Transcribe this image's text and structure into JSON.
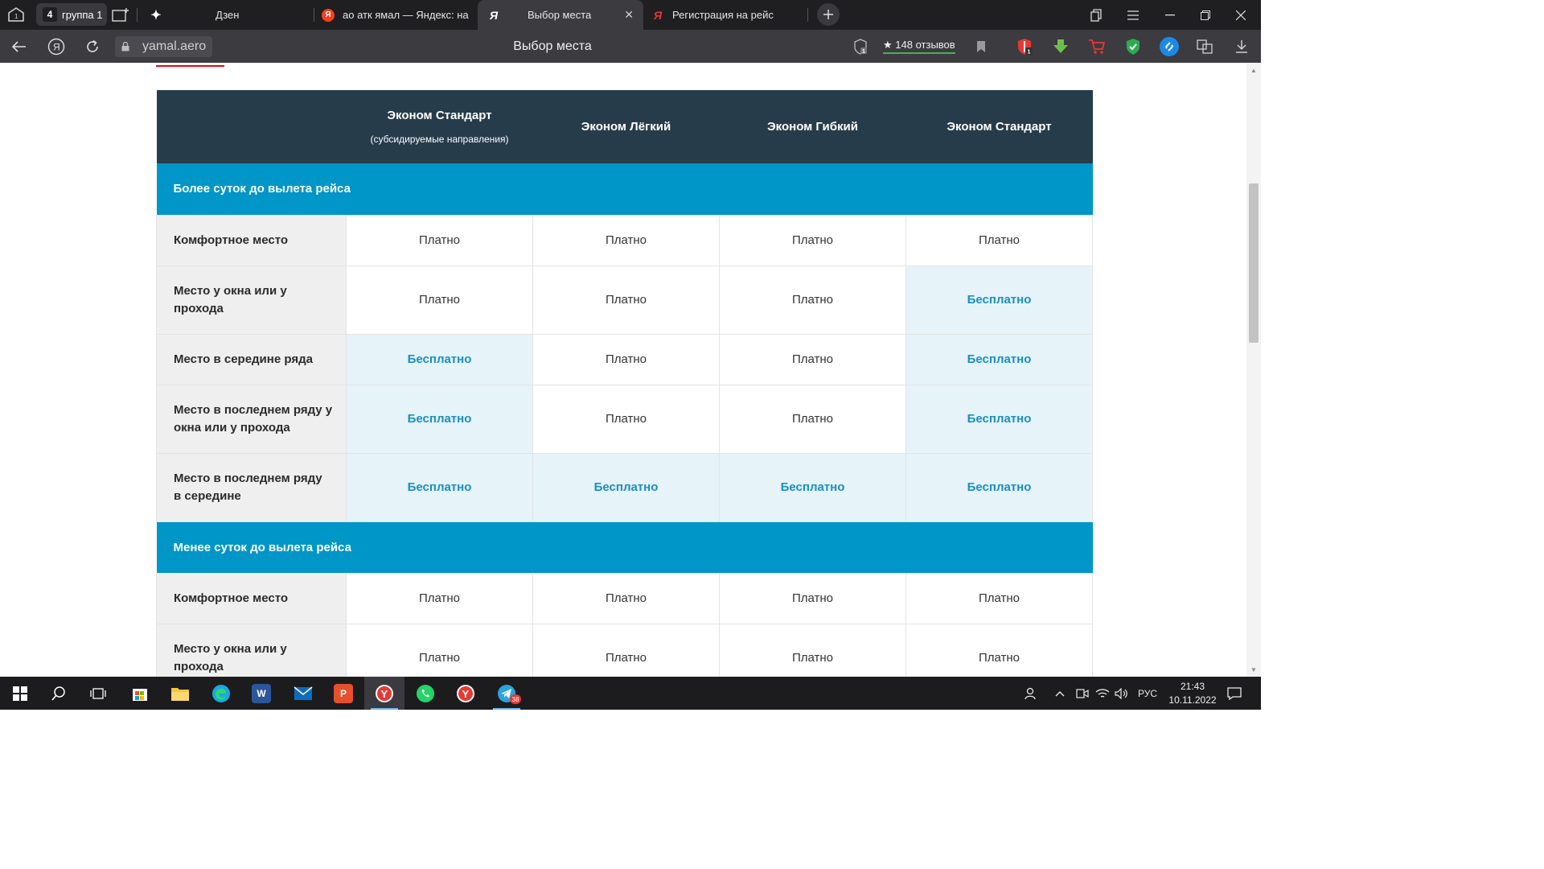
{
  "browser": {
    "tab_group": {
      "count": "4",
      "label": "группа 1"
    },
    "tabs": [
      {
        "label": "Дзен",
        "favicon": "dzen-icon"
      },
      {
        "label": "ао атк ямал — Яндекс: на",
        "favicon": "yandex-icon"
      },
      {
        "label": "Выбор места",
        "favicon": "yandex-browser-icon"
      },
      {
        "label": "Регистрация на рейс",
        "favicon": "yandex-browser-icon"
      }
    ],
    "address": {
      "domain": "yamal.aero",
      "page_title": "Выбор места",
      "reviews": "148 отзывов"
    }
  },
  "table": {
    "headers": [
      {
        "title": "",
        "sub": ""
      },
      {
        "title": "Эконом Стандарт",
        "sub": "(субсидируемые направления)"
      },
      {
        "title": "Эконом Лёгкий",
        "sub": ""
      },
      {
        "title": "Эконом Гибкий",
        "sub": ""
      },
      {
        "title": "Эконом Стандарт",
        "sub": ""
      }
    ],
    "sections": [
      {
        "title": "Более суток до вылета рейса",
        "rows": [
          {
            "label": "Комфортное место",
            "cells": [
              "Платно",
              "Платно",
              "Платно",
              "Платно"
            ]
          },
          {
            "label": "Место у окна или у прохода",
            "cells": [
              "Платно",
              "Платно",
              "Платно",
              "Бесплатно"
            ]
          },
          {
            "label": "Место в середине ряда",
            "cells": [
              "Бесплатно",
              "Платно",
              "Платно",
              "Бесплатно"
            ]
          },
          {
            "label": "Место в последнем ряду у окна или у прохода",
            "cells": [
              "Бесплатно",
              "Платно",
              "Платно",
              "Бесплатно"
            ]
          },
          {
            "label": "Место в последнем ряду в середине",
            "cells": [
              "Бесплатно",
              "Бесплатно",
              "Бесплатно",
              "Бесплатно"
            ]
          }
        ]
      },
      {
        "title": "Менее суток до вылета рейса",
        "rows": [
          {
            "label": "Комфортное место",
            "cells": [
              "Платно",
              "Платно",
              "Платно",
              "Платно"
            ]
          },
          {
            "label": "Место у окна или у прохода",
            "cells": [
              "Платно",
              "Платно",
              "Платно",
              "Платно"
            ]
          }
        ]
      }
    ]
  },
  "taskbar": {
    "telegram_badge": "38",
    "language": "РУС",
    "time": "21:43",
    "date": "10.11.2022"
  },
  "colors": {
    "header_bg": "#263c4a",
    "section_bg": "#0096c7",
    "free_text": "#1a8fc1",
    "free_bg": "#e6f3f9",
    "label_bg": "#efefef"
  }
}
